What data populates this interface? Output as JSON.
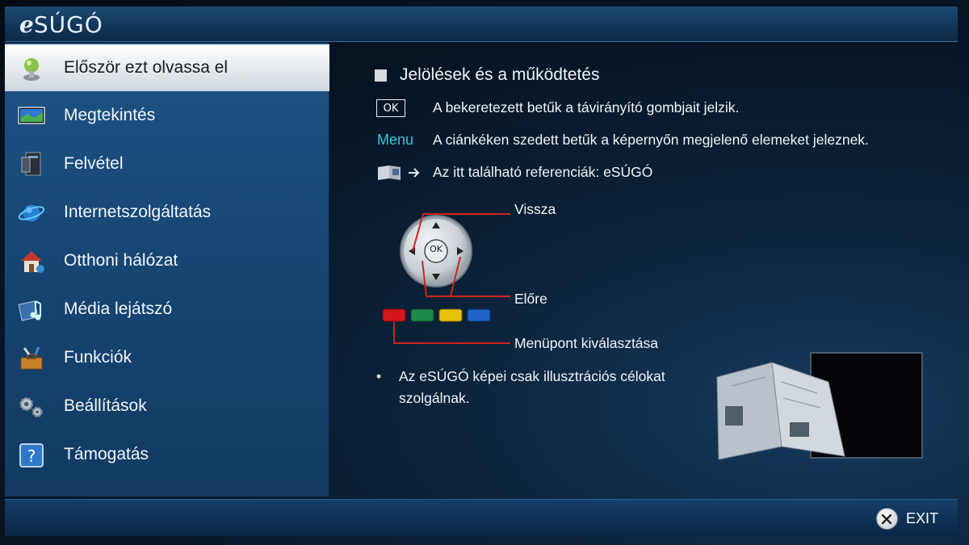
{
  "app": {
    "logo_e": "e",
    "logo_rest": "SÚGÓ"
  },
  "sidebar": {
    "items": [
      {
        "label": "Először ezt olvassa el",
        "icon": "info-person-icon",
        "active": true
      },
      {
        "label": "Megtekintés",
        "icon": "tv-screen-icon",
        "active": false
      },
      {
        "label": "Felvétel",
        "icon": "recorder-icon",
        "active": false
      },
      {
        "label": "Internetszolgáltatás",
        "icon": "globe-icon",
        "active": false
      },
      {
        "label": "Otthoni hálózat",
        "icon": "home-network-icon",
        "active": false
      },
      {
        "label": "Média lejátszó",
        "icon": "media-player-icon",
        "active": false
      },
      {
        "label": "Funkciók",
        "icon": "toolbox-icon",
        "active": false
      },
      {
        "label": "Beállítások",
        "icon": "gears-icon",
        "active": false
      },
      {
        "label": "Támogatás",
        "icon": "question-icon",
        "active": false
      }
    ]
  },
  "content": {
    "heading": "Jelölések és a működtetés",
    "ok_label": "OK",
    "ok_desc": "A bekeretezett betűk a távirányító gombjait jelzik.",
    "menu_word": "Menu",
    "menu_desc": "A ciánkéken szedett betűk a képernyőn megjelenő elemeket jeleznek.",
    "ref_desc": "Az itt található referenciák: eSÚGÓ",
    "callout_back": "Vissza",
    "callout_forward": "Előre",
    "callout_select": "Menüpont kiválasztása",
    "remote_ok": "OK",
    "bullet_dot": "•",
    "bullet_text": "Az eSÚGÓ képei csak illusztrációs célokat szolgálnak."
  },
  "colors": {
    "accent_cyan": "#35c6e2",
    "callout_line": "#d0251c",
    "btn_red": "#d6161b",
    "btn_green": "#1b8a4a",
    "btn_yellow": "#e8c30e",
    "btn_blue": "#1e63c8"
  },
  "footer": {
    "exit_label": "EXIT",
    "exit_icon": "close-x-icon"
  }
}
